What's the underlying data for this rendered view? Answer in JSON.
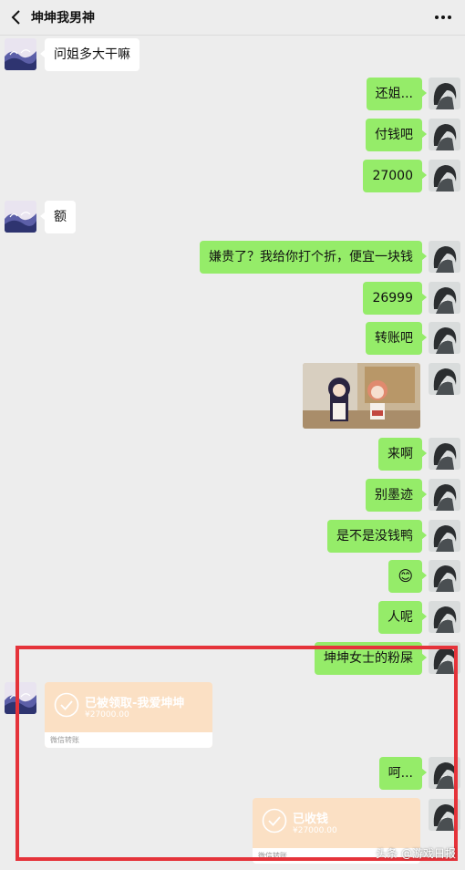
{
  "header": {
    "title": "坤坤我男神",
    "back_icon": "chevron-left-icon",
    "more_icon": "more-dots-icon"
  },
  "messages": [
    {
      "from": "other",
      "text": "问姐多大干嘛"
    },
    {
      "from": "me",
      "text": "还姐..."
    },
    {
      "from": "me",
      "text": "付钱吧"
    },
    {
      "from": "me",
      "text": "27000"
    },
    {
      "from": "other",
      "text": "额"
    },
    {
      "from": "me",
      "text": "嫌贵了？我给你打个折，便宜一块钱"
    },
    {
      "from": "me",
      "text": "26999"
    },
    {
      "from": "me",
      "text": "转账吧"
    },
    {
      "from": "me",
      "type": "sticker",
      "icon": "anime-sticker-image"
    },
    {
      "from": "me",
      "text": "来啊"
    },
    {
      "from": "me",
      "text": "别墨迹"
    },
    {
      "from": "me",
      "text": "是不是没钱鸭"
    },
    {
      "from": "me",
      "text": "😊"
    },
    {
      "from": "me",
      "text": "人呢"
    },
    {
      "from": "me",
      "text": "坤坤女士的粉屎"
    },
    {
      "from": "other",
      "type": "transfer",
      "title": "已被领取-我爱坤坤",
      "amount": "¥27000.00",
      "footer": "微信转账"
    },
    {
      "from": "me",
      "text": "呵..."
    },
    {
      "from": "me",
      "type": "transfer",
      "title": "已收钱",
      "amount": "¥27000.00",
      "footer": "微信转账"
    }
  ],
  "colors": {
    "my_bubble": "#95ec69",
    "other_bubble": "#ffffff",
    "transfer_bg": "#fbe0c4",
    "highlight": "#e5333a",
    "background": "#ededed"
  },
  "watermark": "头条 @游戏日报"
}
